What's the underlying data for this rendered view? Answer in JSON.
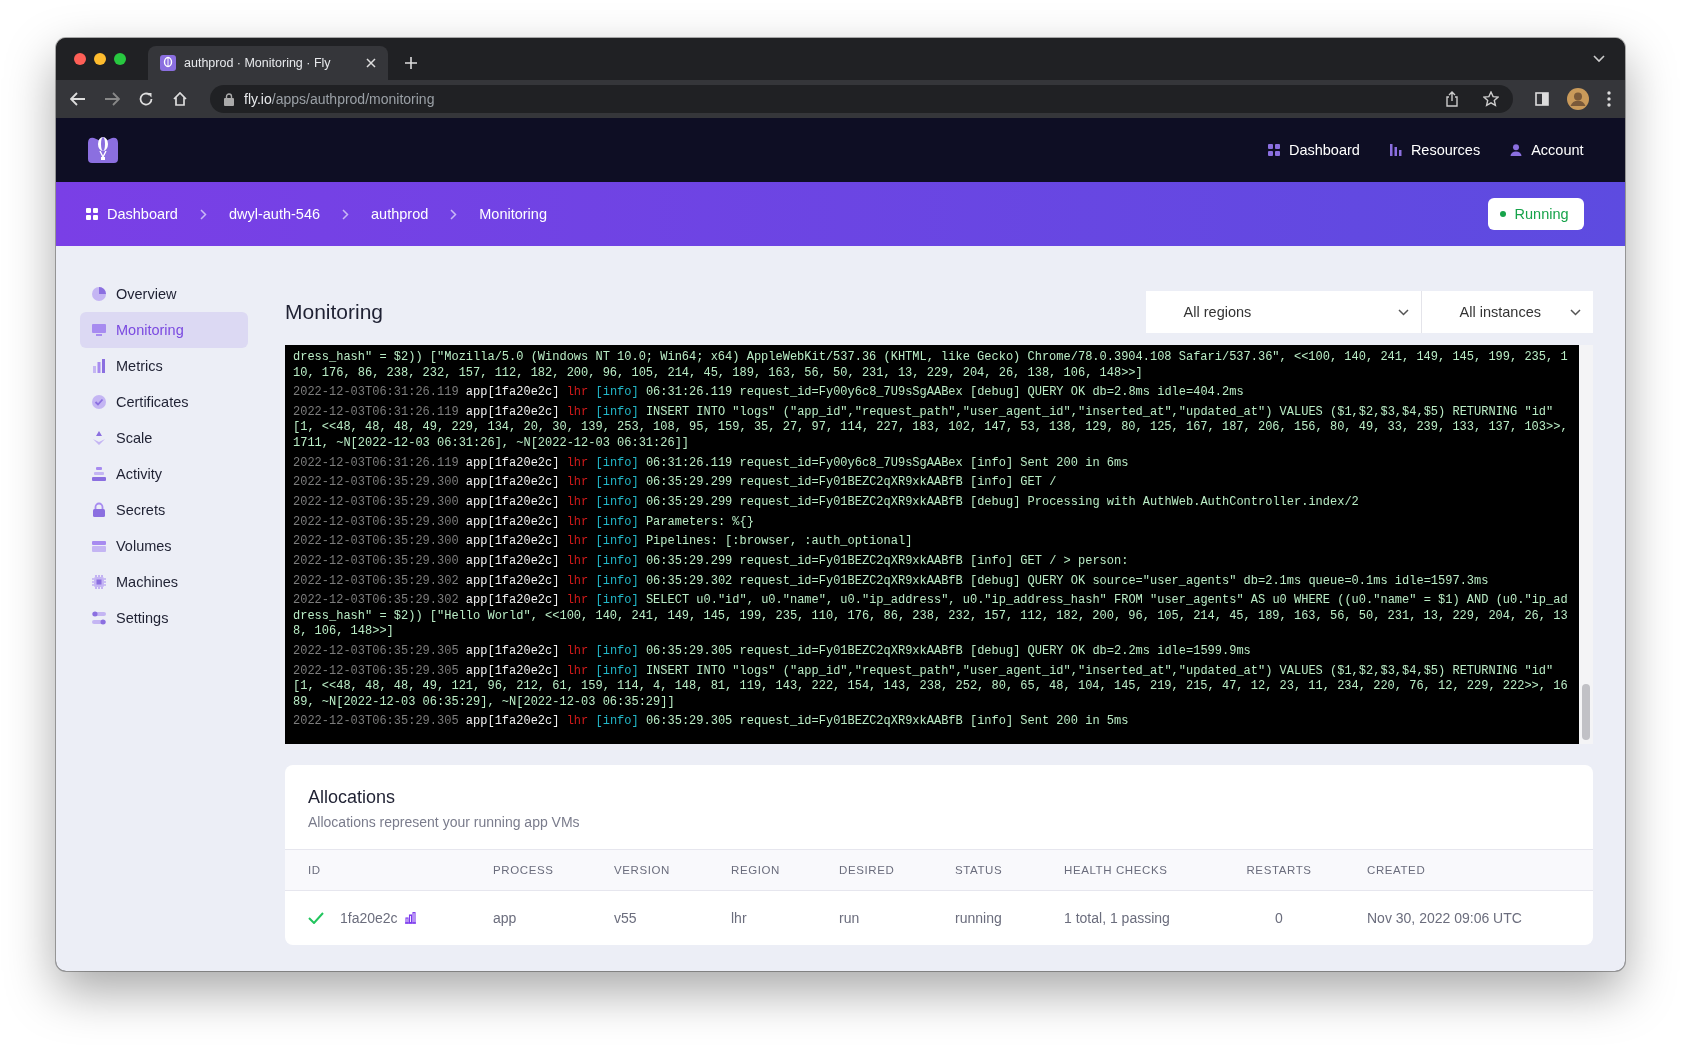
{
  "browser": {
    "tab_title": "authprod · Monitoring · Fly",
    "url_host": "fly.io",
    "url_path": "/apps/authprod/monitoring"
  },
  "top_nav": [
    {
      "label": "Dashboard",
      "kind": "grid"
    },
    {
      "label": "Resources",
      "kind": "bars"
    },
    {
      "label": "Account",
      "kind": "person"
    }
  ],
  "breadcrumb": [
    {
      "label": "Dashboard",
      "kind": "grid"
    },
    {
      "label": "dwyl-auth-546",
      "kind": "text"
    },
    {
      "label": "authprod",
      "kind": "text"
    },
    {
      "label": "Monitoring",
      "kind": "text"
    }
  ],
  "status": {
    "label": "Running"
  },
  "sidebar": {
    "items": [
      {
        "label": "Overview",
        "kind": "overview",
        "selected": false
      },
      {
        "label": "Monitoring",
        "kind": "monitoring",
        "selected": true
      },
      {
        "label": "Metrics",
        "kind": "metrics",
        "selected": false
      },
      {
        "label": "Certificates",
        "kind": "certificates",
        "selected": false
      },
      {
        "label": "Scale",
        "kind": "scale",
        "selected": false
      },
      {
        "label": "Activity",
        "kind": "activity",
        "selected": false
      },
      {
        "label": "Secrets",
        "kind": "secrets",
        "selected": false
      },
      {
        "label": "Volumes",
        "kind": "volumes",
        "selected": false
      },
      {
        "label": "Machines",
        "kind": "machines",
        "selected": false
      },
      {
        "label": "Settings",
        "kind": "settings",
        "selected": false
      }
    ]
  },
  "page_title": "Monitoring",
  "filters": [
    {
      "value": "All regions"
    },
    {
      "value": "All instances"
    }
  ],
  "logs": [
    {
      "message": "dress_hash\" = $2)) [\"Mozilla/5.0 (Windows NT 10.0; Win64; x64) AppleWebKit/537.36 (KHTML, like Gecko) Chrome/78.0.3904.108 Safari/537.36\", <<100, 140, 241, 149, 145, 199, 235, 110, 176, 86, 238, 232, 157, 112, 182, 200, 96, 105, 214, 45, 189, 163, 56, 50, 231, 13, 229, 204, 26, 138, 106, 148>>]"
    },
    {
      "timestamp": "2022-12-03T06:31:26.119",
      "source": "app[1fa20e2c]",
      "region": "lhr",
      "level": "[info]",
      "message": "06:31:26.119 request_id=Fy00y6c8_7U9sSgAABex [debug] QUERY OK db=2.8ms idle=404.2ms"
    },
    {
      "timestamp": "2022-12-03T06:31:26.119",
      "source": "app[1fa20e2c]",
      "region": "lhr",
      "level": "[info]",
      "message": "INSERT INTO \"logs\" (\"app_id\",\"request_path\",\"user_agent_id\",\"inserted_at\",\"updated_at\") VALUES ($1,$2,$3,$4,$5) RETURNING \"id\" [1, <<48, 48, 48, 49, 229, 134, 20, 30, 139, 253, 108, 95, 159, 35, 27, 97, 114, 227, 183, 102, 147, 53, 138, 129, 80, 125, 167, 187, 206, 156, 80, 49, 33, 239, 133, 137, 103>>, 1711, ~N[2022-12-03 06:31:26], ~N[2022-12-03 06:31:26]]"
    },
    {
      "timestamp": "2022-12-03T06:31:26.119",
      "source": "app[1fa20e2c]",
      "region": "lhr",
      "level": "[info]",
      "message": "06:31:26.119 request_id=Fy00y6c8_7U9sSgAABex [info] Sent 200 in 6ms"
    },
    {
      "timestamp": "2022-12-03T06:35:29.300",
      "source": "app[1fa20e2c]",
      "region": "lhr",
      "level": "[info]",
      "message": "06:35:29.299 request_id=Fy01BEZC2qXR9xkAABfB [info] GET /"
    },
    {
      "timestamp": "2022-12-03T06:35:29.300",
      "source": "app[1fa20e2c]",
      "region": "lhr",
      "level": "[info]",
      "message": "06:35:29.299 request_id=Fy01BEZC2qXR9xkAABfB [debug] Processing with AuthWeb.AuthController.index/2"
    },
    {
      "timestamp": "2022-12-03T06:35:29.300",
      "source": "app[1fa20e2c]",
      "region": "lhr",
      "level": "[info]",
      "message": "Parameters: %{}"
    },
    {
      "timestamp": "2022-12-03T06:35:29.300",
      "source": "app[1fa20e2c]",
      "region": "lhr",
      "level": "[info]",
      "message": "Pipelines: [:browser, :auth_optional]"
    },
    {
      "timestamp": "2022-12-03T06:35:29.300",
      "source": "app[1fa20e2c]",
      "region": "lhr",
      "level": "[info]",
      "message": "06:35:29.299 request_id=Fy01BEZC2qXR9xkAABfB [info] GET / > person:"
    },
    {
      "timestamp": "2022-12-03T06:35:29.302",
      "source": "app[1fa20e2c]",
      "region": "lhr",
      "level": "[info]",
      "message": "06:35:29.302 request_id=Fy01BEZC2qXR9xkAABfB [debug] QUERY OK source=\"user_agents\" db=2.1ms queue=0.1ms idle=1597.3ms"
    },
    {
      "timestamp": "2022-12-03T06:35:29.302",
      "source": "app[1fa20e2c]",
      "region": "lhr",
      "level": "[info]",
      "message": "SELECT u0.\"id\", u0.\"name\", u0.\"ip_address\", u0.\"ip_address_hash\" FROM \"user_agents\" AS u0 WHERE ((u0.\"name\" = $1) AND (u0.\"ip_address_hash\" = $2)) [\"Hello World\", <<100, 140, 241, 149, 145, 199, 235, 110, 176, 86, 238, 232, 157, 112, 182, 200, 96, 105, 214, 45, 189, 163, 56, 50, 231, 13, 229, 204, 26, 138, 106, 148>>]"
    },
    {
      "timestamp": "2022-12-03T06:35:29.305",
      "source": "app[1fa20e2c]",
      "region": "lhr",
      "level": "[info]",
      "message": "06:35:29.305 request_id=Fy01BEZC2qXR9xkAABfB [debug] QUERY OK db=2.2ms idle=1599.9ms"
    },
    {
      "timestamp": "2022-12-03T06:35:29.305",
      "source": "app[1fa20e2c]",
      "region": "lhr",
      "level": "[info]",
      "message": "INSERT INTO \"logs\" (\"app_id\",\"request_path\",\"user_agent_id\",\"inserted_at\",\"updated_at\") VALUES ($1,$2,$3,$4,$5) RETURNING \"id\" [1, <<48, 48, 48, 49, 121, 96, 212, 61, 159, 114, 4, 148, 81, 119, 143, 222, 154, 143, 238, 252, 80, 65, 48, 104, 145, 219, 215, 47, 12, 23, 11, 234, 220, 76, 12, 229, 222>>, 1689, ~N[2022-12-03 06:35:29], ~N[2022-12-03 06:35:29]]"
    },
    {
      "timestamp": "2022-12-03T06:35:29.305",
      "source": "app[1fa20e2c]",
      "region": "lhr",
      "level": "[info]",
      "message": "06:35:29.305 request_id=Fy01BEZC2qXR9xkAABfB [info] Sent 200 in 5ms"
    }
  ],
  "allocations": {
    "title": "Allocations",
    "subtitle": "Allocations represent your running app VMs",
    "columns": [
      "ID",
      "PROCESS",
      "VERSION",
      "REGION",
      "DESIRED",
      "STATUS",
      "HEALTH CHECKS",
      "RESTARTS",
      "CREATED"
    ],
    "rows": [
      {
        "cells": [
          "1fa20e2c",
          "app",
          "v55",
          "lhr",
          "run",
          "running",
          "1 total, 1 passing",
          "0",
          "Nov 30, 2022 09:06 UTC"
        ]
      }
    ]
  }
}
